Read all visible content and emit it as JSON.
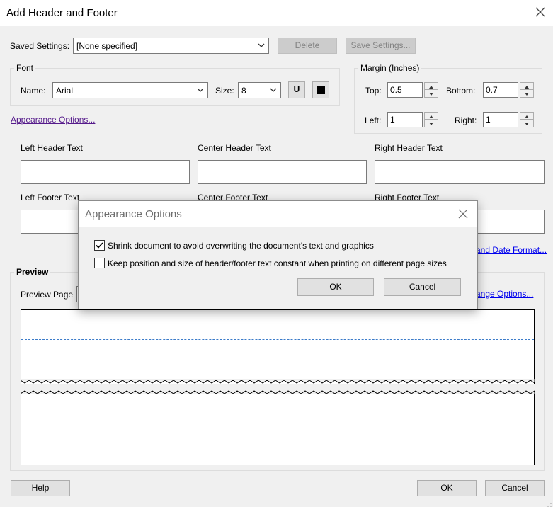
{
  "window": {
    "title": "Add Header and Footer"
  },
  "saved_settings": {
    "label": "Saved Settings:",
    "value": "[None specified]",
    "delete_label": "Delete",
    "save_label": "Save Settings..."
  },
  "font": {
    "group_title": "Font",
    "name_label": "Name:",
    "name_value": "Arial",
    "size_label": "Size:",
    "size_value": "8",
    "underline_glyph": "U"
  },
  "margin": {
    "group_title": "Margin (Inches)",
    "top_label": "Top:",
    "top_value": "0.5",
    "bottom_label": "Bottom:",
    "bottom_value": "0.7",
    "left_label": "Left:",
    "left_value": "1",
    "right_label": "Right:",
    "right_value": "1"
  },
  "appearance_link": "Appearance Options...",
  "header_texts": {
    "left_label": "Left Header Text",
    "center_label": "Center Header Text",
    "right_label": "Right Header Text"
  },
  "footer_texts": {
    "left_label": "Left Footer Text",
    "center_label": "Center Footer Text",
    "right_label": "Right Footer Text"
  },
  "page_number_link": "and Date Format...",
  "preview": {
    "title": "Preview",
    "page_label": "Preview Page",
    "range_link": "ange Options..."
  },
  "footer_buttons": {
    "help": "Help",
    "ok": "OK",
    "cancel": "Cancel"
  },
  "dialog": {
    "title": "Appearance Options",
    "option1_label": "Shrink document to avoid overwriting  the document's text and graphics",
    "option1_checked": true,
    "option2_label": "Keep position and size of header/footer text constant when printing on different page sizes",
    "option2_checked": false,
    "ok": "OK",
    "cancel": "Cancel"
  }
}
